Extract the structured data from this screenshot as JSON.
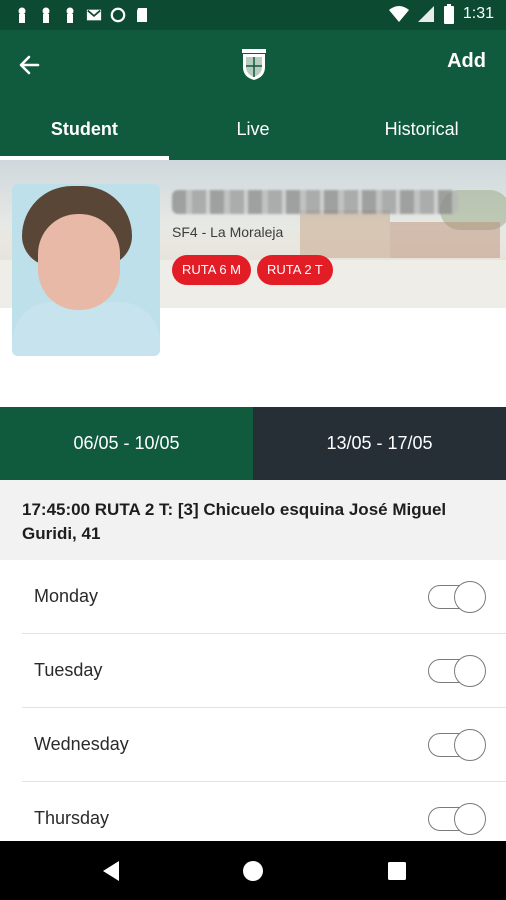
{
  "status_bar": {
    "time": "1:31",
    "left_icons": [
      "notification-icon",
      "notification-icon",
      "notification-icon",
      "gmail-icon",
      "circle-icon",
      "sd-card-icon"
    ],
    "right_icons": [
      "wifi-icon",
      "signal-icon",
      "battery-icon"
    ]
  },
  "app_bar": {
    "back_icon": "arrow-back-icon",
    "logo_icon": "school-crest-icon",
    "add_label": "Add"
  },
  "tabs": [
    {
      "label": "Student",
      "active": true
    },
    {
      "label": "Live",
      "active": false
    },
    {
      "label": "Historical",
      "active": false
    }
  ],
  "student": {
    "school": "SF4 - La Moraleja",
    "routes": [
      "RUTA 6 M",
      "RUTA 2 T"
    ]
  },
  "weeks": [
    {
      "label": "06/05 - 10/05"
    },
    {
      "label": "13/05 - 17/05"
    }
  ],
  "route_info": "17:45:00 RUTA 2 T: [3] Chicuelo esquina José Miguel Guridi, 41",
  "days": [
    {
      "label": "Monday",
      "enabled": false
    },
    {
      "label": "Tuesday",
      "enabled": false
    },
    {
      "label": "Wednesday",
      "enabled": false
    },
    {
      "label": "Thursday",
      "enabled": false
    }
  ],
  "colors": {
    "primary": "#105a3d",
    "status_bar": "#0d4a32",
    "week_inactive": "#262e36",
    "badge": "#e21d26"
  }
}
